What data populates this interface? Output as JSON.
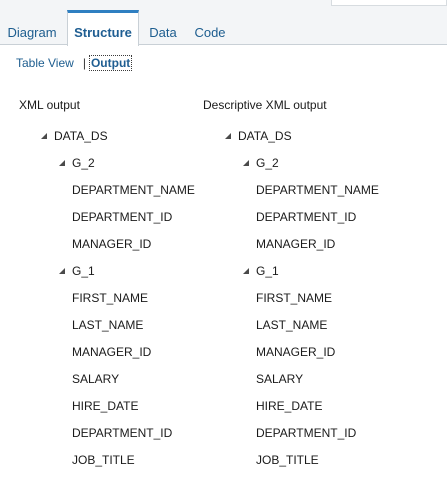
{
  "tabs": {
    "diagram": "Diagram",
    "structure": "Structure",
    "data": "Data",
    "code": "Code"
  },
  "subnav": {
    "table_view": "Table View",
    "separator": "|",
    "output": "Output"
  },
  "left": {
    "heading": "XML output",
    "root": "DATA_DS",
    "group2": "G_2",
    "g2_fields": [
      "DEPARTMENT_NAME",
      "DEPARTMENT_ID",
      "MANAGER_ID"
    ],
    "group1": "G_1",
    "g1_fields": [
      "FIRST_NAME",
      "LAST_NAME",
      "MANAGER_ID",
      "SALARY",
      "HIRE_DATE",
      "DEPARTMENT_ID",
      "JOB_TITLE"
    ]
  },
  "right": {
    "heading": "Descriptive XML output",
    "root": "DATA_DS",
    "group2": "G_2",
    "g2_fields": [
      "DEPARTMENT_NAME",
      "DEPARTMENT_ID",
      "MANAGER_ID"
    ],
    "group1": "G_1",
    "g1_fields": [
      "FIRST_NAME",
      "LAST_NAME",
      "MANAGER_ID",
      "SALARY",
      "HIRE_DATE",
      "DEPARTMENT_ID",
      "JOB_TITLE"
    ]
  }
}
